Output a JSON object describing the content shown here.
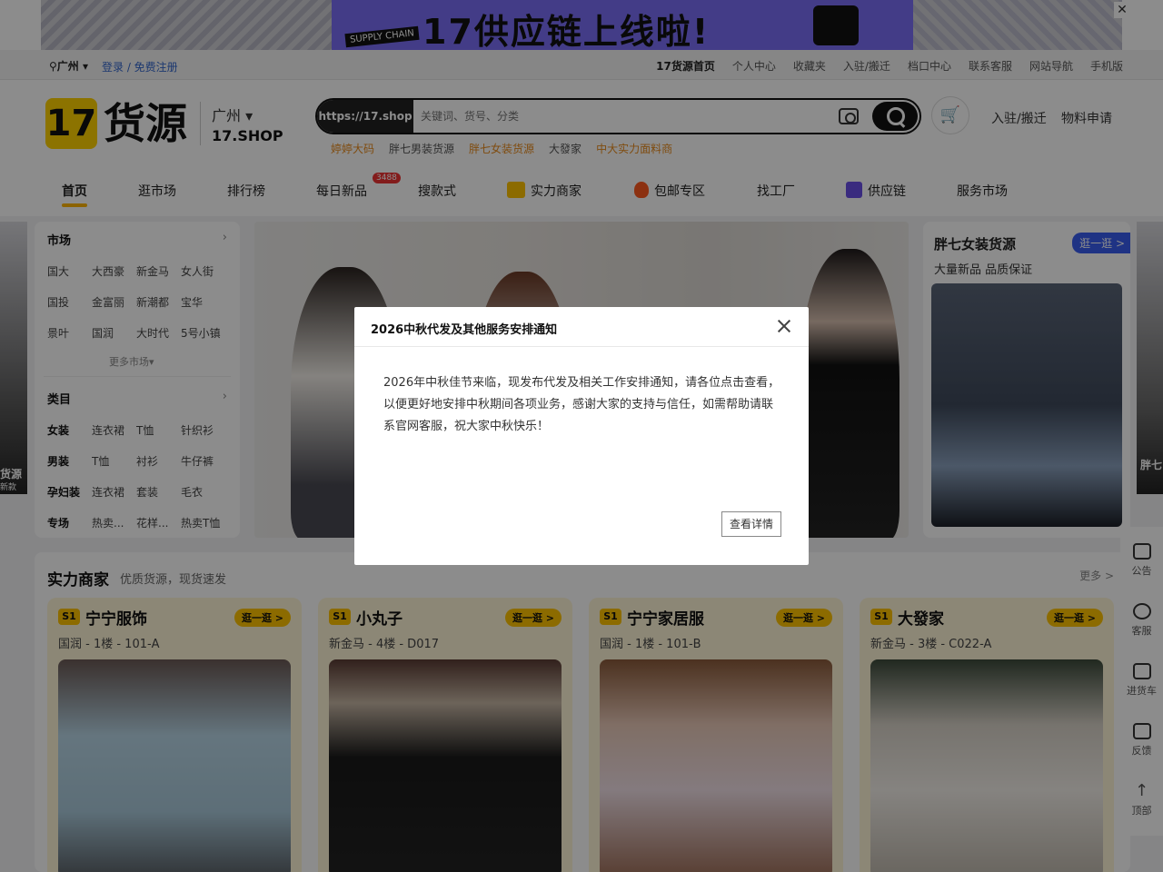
{
  "banner": {
    "tag": "SUPPLY CHAIN",
    "slogan": "17供应链上线啦!",
    "close_icon": "close-icon"
  },
  "topbar": {
    "city": "广州",
    "login": "登录 / 免费注册",
    "links": [
      "17货源首页",
      "个人中心",
      "收藏夹",
      "入驻/搬迁",
      "档口中心",
      "联系客服",
      "网站导航",
      "手机版"
    ]
  },
  "header": {
    "logo_mark": "17",
    "logo_text": "货源",
    "location": "广州",
    "shop_text": "17.SHOP",
    "search_prefix": "https://17.shop",
    "search_placeholder": "关键词、货号、分类",
    "link_settle": "入驻/搬迁",
    "link_material": "物料申请",
    "hot_words": [
      "婷婷大码",
      "胖七男装货源",
      "胖七女装货源",
      "大發家",
      "中大实力面料商"
    ]
  },
  "nav": {
    "items": [
      "首页",
      "逛市场",
      "排行榜",
      "每日新品",
      "搜款式",
      "实力商家",
      "包邮专区",
      "找工厂",
      "供应链",
      "服务市场"
    ],
    "badge": "3488"
  },
  "categories": {
    "market_title": "市场",
    "market_rows": [
      [
        "国大",
        "大西豪",
        "新金马",
        "女人街"
      ],
      [
        "国投",
        "金富丽",
        "新潮都",
        "宝华"
      ],
      [
        "景叶",
        "国润",
        "大时代",
        "5号小镇"
      ]
    ],
    "market_more": "更多市场",
    "category_title": "类目",
    "category_rows": [
      [
        "女装",
        "连衣裙",
        "T恤",
        "针织衫"
      ],
      [
        "男装",
        "T恤",
        "衬衫",
        "牛仔裤"
      ],
      [
        "孕妇装",
        "连衣裙",
        "套装",
        "毛衣"
      ],
      [
        "专场",
        "热卖...",
        "花样...",
        "热卖T恤"
      ]
    ]
  },
  "promo": {
    "title": "胖七女装货源",
    "subtitle": "大量新品 品质保证",
    "button": "逛一逛 >"
  },
  "ghost": {
    "left_title": "货源",
    "left_sub": "新款",
    "right_title": "胖七"
  },
  "section": {
    "title": "实力商家",
    "subtitle": "优质货源，现货速发",
    "more": "更多 >",
    "shops": [
      {
        "badge": "S1",
        "name": "宁宁服饰",
        "address": "国润 - 1楼 - 101-A",
        "button": "逛一逛 >"
      },
      {
        "badge": "S1",
        "name": "小丸子",
        "address": "新金马 - 4楼 - D017",
        "button": "逛一逛 >"
      },
      {
        "badge": "S1",
        "name": "宁宁家居服",
        "address": "国润 - 1楼 - 101-B",
        "button": "逛一逛 >"
      },
      {
        "badge": "S1",
        "name": "大發家",
        "address": "新金马 - 3楼 - C022-A",
        "button": "逛一逛 >"
      }
    ]
  },
  "sidebar": {
    "items": [
      "公告",
      "客服",
      "进货车",
      "反馈",
      "顶部"
    ]
  },
  "modal": {
    "title": "2026中秋代发及其他服务安排通知",
    "body": "2026年中秋佳节来临，现发布代发及相关工作安排通知，请各位点击查看，以便更好地安排中秋期间各项业务，感谢大家的支持与信任，如需帮助请联系官网客服，祝大家中秋快乐！",
    "button": "查看详情"
  }
}
